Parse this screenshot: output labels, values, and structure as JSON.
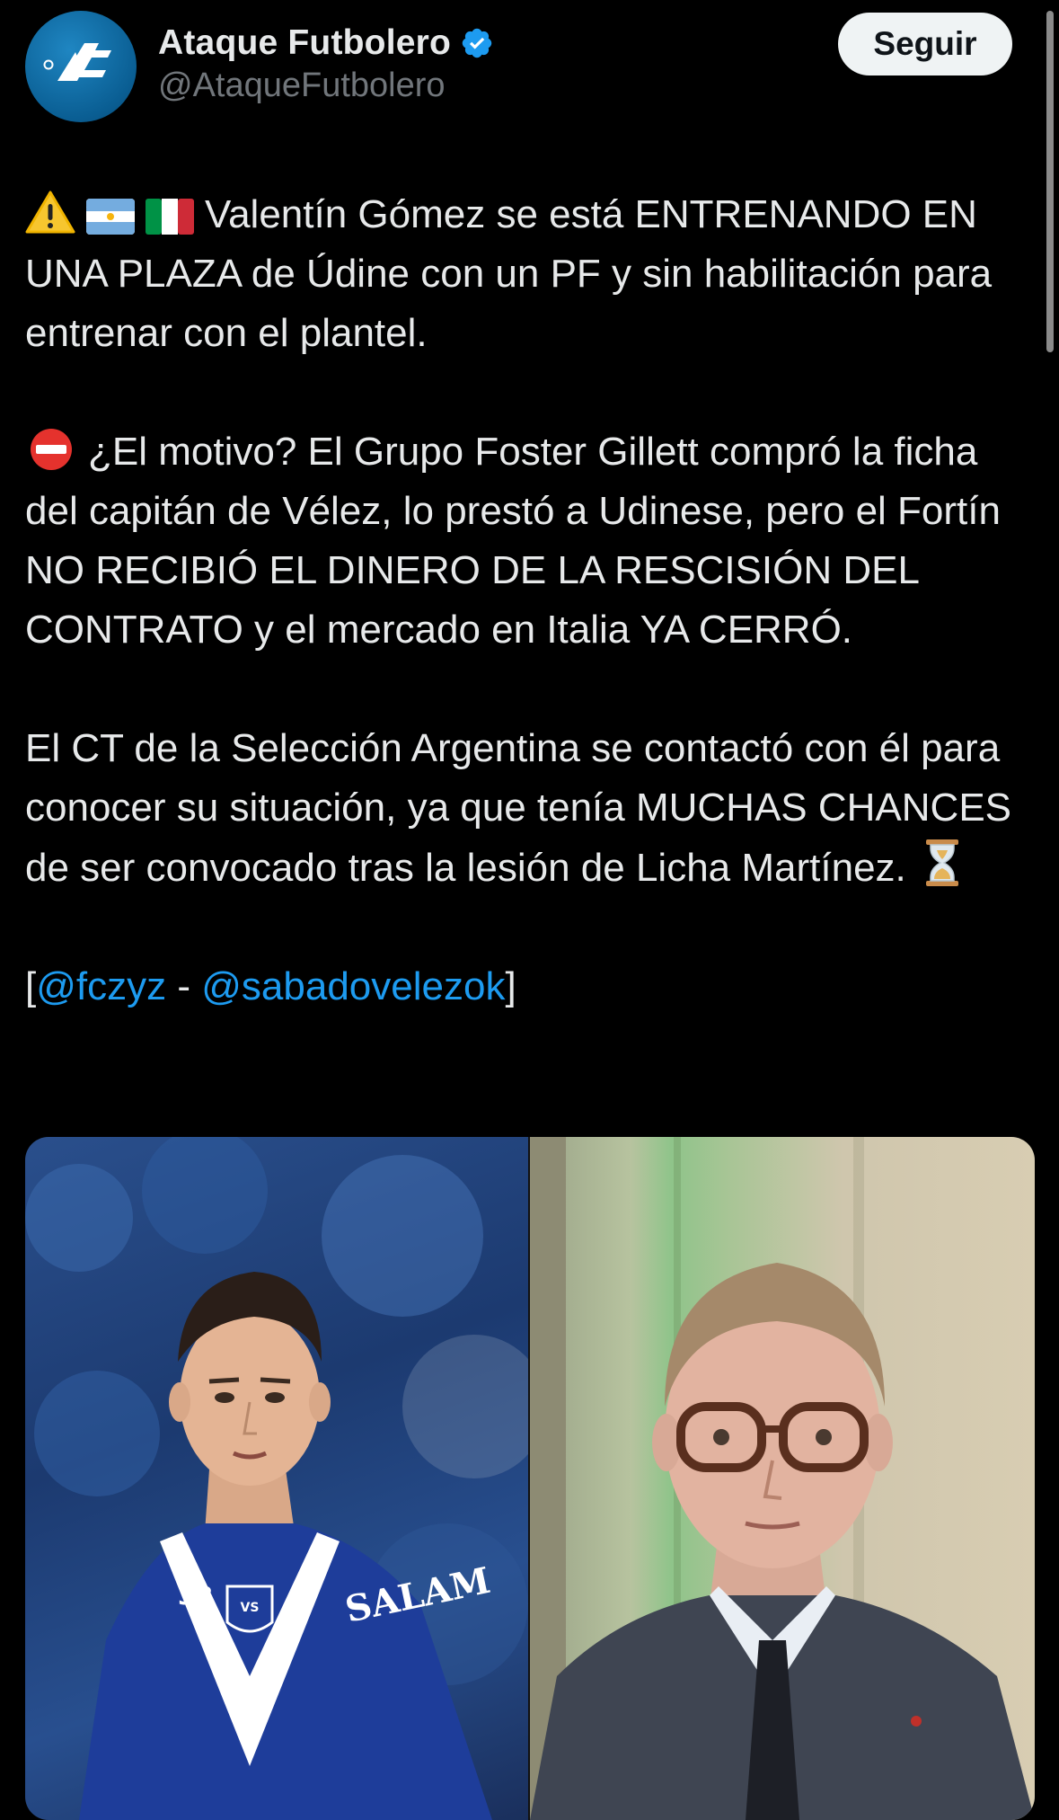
{
  "author": {
    "display_name": "Ataque Futbolero",
    "handle": "@AtaqueFutbolero",
    "verified": true,
    "avatar_icon": "ataque-futbolero-logo"
  },
  "follow_button": {
    "label": "Seguir"
  },
  "tweet": {
    "paragraphs": [
      {
        "emojis": [
          "warning-emoji",
          "argentina-flag-emoji",
          "italy-flag-emoji"
        ],
        "text": "Valentín Gómez se está ENTRENANDO EN UNA PLAZA de Údine con un PF y sin habilitación para entrenar con el plantel."
      },
      {
        "emojis": [
          "no-entry-emoji"
        ],
        "text": "¿El motivo? El Grupo Foster Gillett compró la ficha del capitán de Vélez, lo prestó a Udinese, pero el Fortín NO RECIBIÓ EL DINERO DE LA RESCISIÓN DEL CONTRATO y el mercado en Italia YA CERRÓ."
      },
      {
        "text": "El CT de la Selección Argentina se contactó con él para conocer su situación, ya que tenía MUCHAS CHANCES de ser convocado tras la lesión de Licha Martínez.",
        "trailing_emoji": "hourglass-emoji"
      },
      {
        "open_bracket": "[",
        "mention_1": "@fczyz",
        "separator": " - ",
        "mention_2": "@sabadovelezok",
        "close_bracket": "]"
      }
    ]
  },
  "media": {
    "left_image": "player-photo",
    "right_image": "businessman-photo",
    "jersey_number": "38",
    "sponsor_text": "SALAM"
  },
  "colors": {
    "background": "#000000",
    "text": "#e7e9ea",
    "secondary_text": "#71767b",
    "link": "#1d9bf0",
    "verified": "#1d9bf0",
    "button_bg": "#eff3f4",
    "button_text": "#0f1419"
  }
}
